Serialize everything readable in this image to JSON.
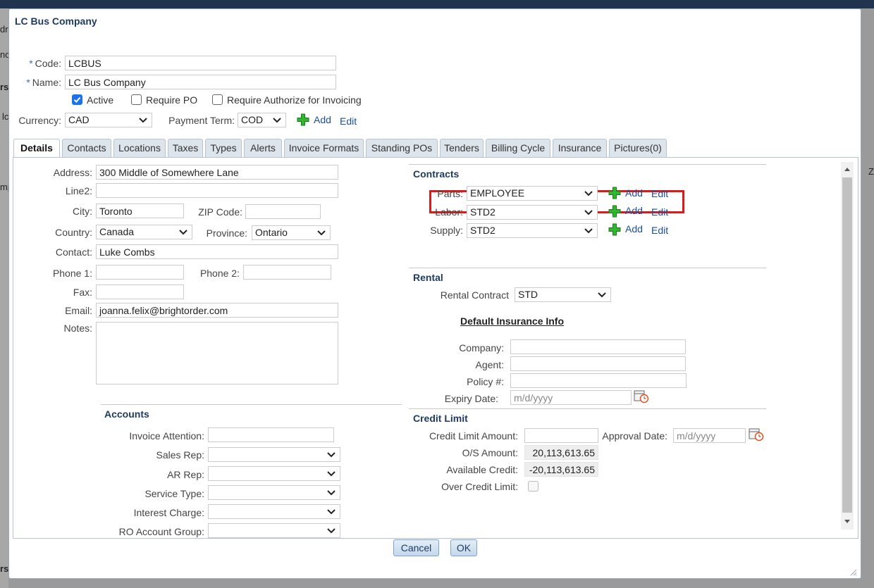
{
  "dialog": {
    "title": "LC Bus Company"
  },
  "header": {
    "code_label": "Code:",
    "code_value": "LCBUS",
    "name_label": "Name:",
    "name_value": "LC Bus Company",
    "req_mark": "*",
    "active_label": "Active",
    "active_checked": true,
    "require_po_label": "Require PO",
    "require_po_checked": false,
    "require_auth_label": "Require Authorize for Invoicing",
    "require_auth_checked": false,
    "currency_label": "Currency:",
    "currency_value": "CAD",
    "payment_term_label": "Payment Term:",
    "payment_term_value": "COD",
    "add_label": "Add",
    "edit_label": "Edit"
  },
  "tabs": [
    {
      "label": "Details",
      "active": true
    },
    {
      "label": "Contacts"
    },
    {
      "label": "Locations"
    },
    {
      "label": "Taxes"
    },
    {
      "label": "Types"
    },
    {
      "label": "Alerts"
    },
    {
      "label": "Invoice Formats"
    },
    {
      "label": "Standing POs"
    },
    {
      "label": "Tenders"
    },
    {
      "label": "Billing Cycle"
    },
    {
      "label": "Insurance"
    },
    {
      "label": "Pictures(0)"
    }
  ],
  "details": {
    "address_label": "Address:",
    "address_value": "300 Middle of Somewhere Lane",
    "line2_label": "Line2:",
    "line2_value": "",
    "city_label": "City:",
    "city_value": "Toronto",
    "zip_label": "ZIP Code:",
    "zip_value": "",
    "country_label": "Country:",
    "country_value": "Canada",
    "province_label": "Province:",
    "province_value": "Ontario",
    "contact_label": "Contact:",
    "contact_value": "Luke Combs",
    "phone1_label": "Phone 1:",
    "phone1_value": "",
    "phone2_label": "Phone 2:",
    "phone2_value": "",
    "fax_label": "Fax:",
    "fax_value": "",
    "email_label": "Email:",
    "email_value": "joanna.felix@brightorder.com",
    "notes_label": "Notes:",
    "notes_value": ""
  },
  "accounts": {
    "title": "Accounts",
    "invoice_attention_label": "Invoice Attention:",
    "sales_rep_label": "Sales Rep:",
    "ar_rep_label": "AR Rep:",
    "service_type_label": "Service Type:",
    "interest_charge_label": "Interest Charge:",
    "ro_account_group_label": "RO Account Group:"
  },
  "contracts": {
    "title": "Contracts",
    "parts_label": "Parts:",
    "parts_value": "EMPLOYEE",
    "labor_label": "Labor:",
    "labor_value": "STD2",
    "supply_label": "Supply:",
    "supply_value": "STD2",
    "add_label": "Add",
    "edit_label": "Edit"
  },
  "rental": {
    "title": "Rental",
    "rental_contract_label": "Rental Contract",
    "rental_contract_value": "STD",
    "default_insurance_title": "Default Insurance Info",
    "company_label": "Company:",
    "agent_label": "Agent:",
    "policy_label": "Policy #:",
    "expiry_label": "Expiry Date:",
    "date_placeholder": "m/d/yyyy"
  },
  "credit": {
    "title": "Credit Limit",
    "credit_limit_label": "Credit Limit Amount:",
    "credit_limit_value": "",
    "approval_date_label": "Approval Date:",
    "approval_date_placeholder": "m/d/yyyy",
    "os_amount_label": "O/S Amount:",
    "os_amount_value": "20,113,613.65",
    "available_credit_label": "Available Credit:",
    "available_credit_value": "-20,113,613.65",
    "over_credit_label": "Over Credit Limit:",
    "over_credit_checked": false
  },
  "footer": {
    "cancel_label": "Cancel",
    "ok_label": "OK"
  },
  "background": {
    "frag1": "dr",
    "frag2": "nc",
    "frag3": "rs",
    "frag4": "lc",
    "frag5": "mp",
    "frag6": "rs",
    "frag7": "Z"
  }
}
